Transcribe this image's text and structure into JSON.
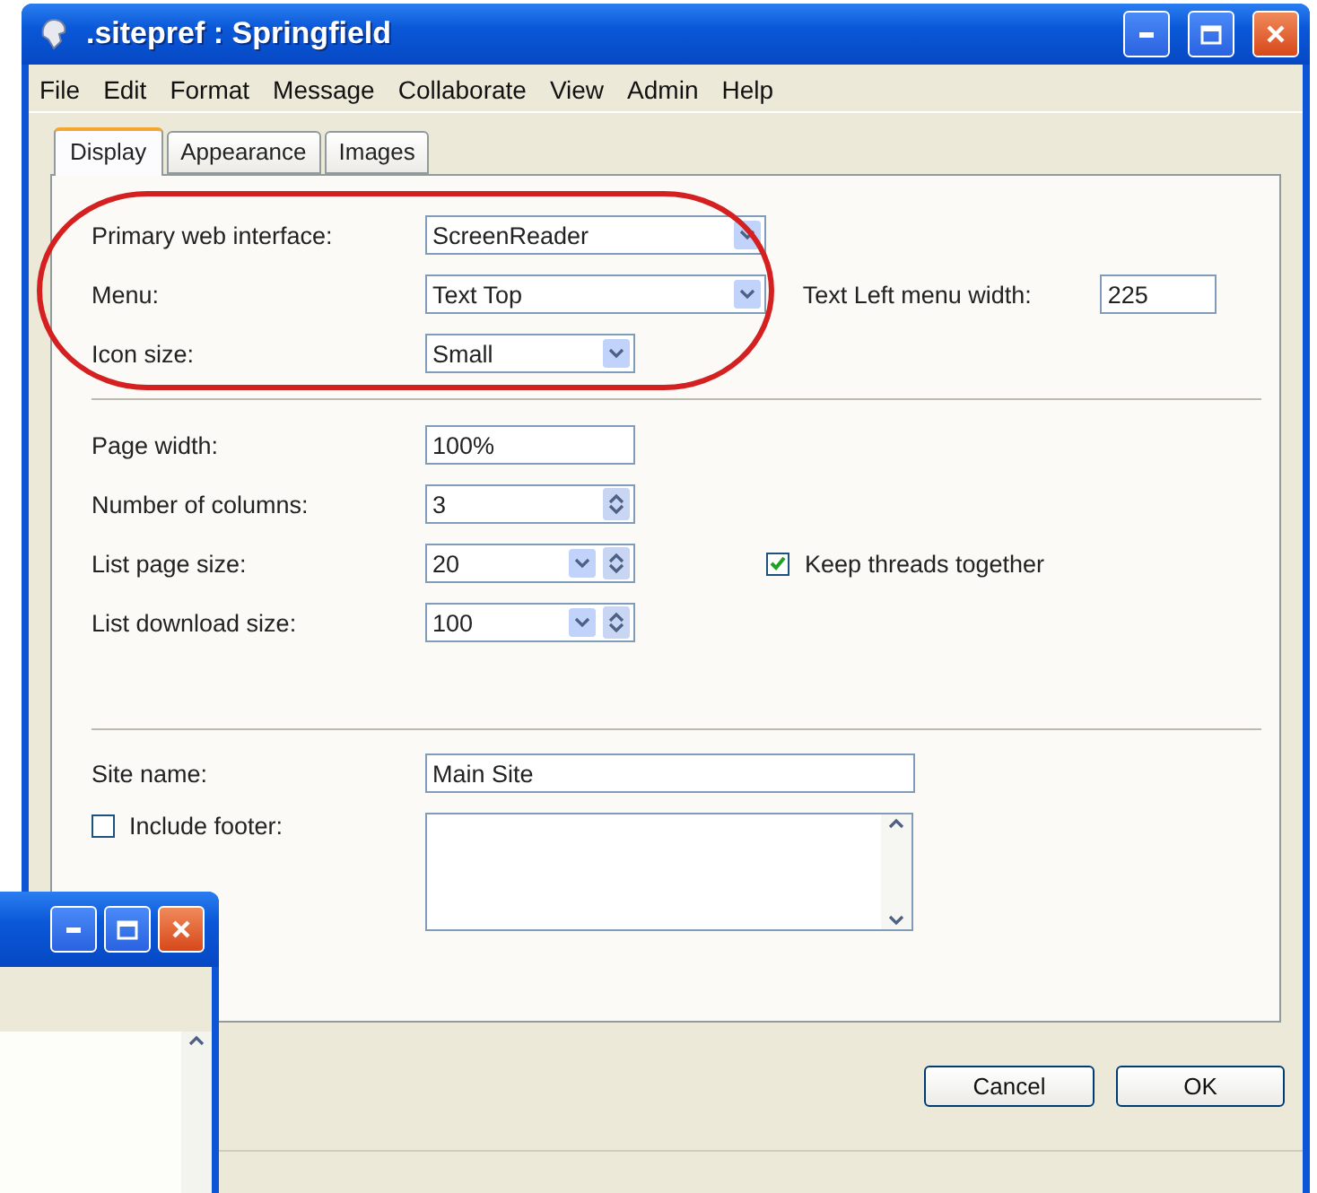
{
  "window": {
    "title": ".sitepref : Springfield"
  },
  "menu": [
    "File",
    "Edit",
    "Format",
    "Message",
    "Collaborate",
    "View",
    "Admin",
    "Help"
  ],
  "tabs": [
    {
      "label": "Display",
      "selected": true
    },
    {
      "label": "Appearance",
      "selected": false
    },
    {
      "label": "Images",
      "selected": false
    }
  ],
  "sections": [
    {
      "rows": [
        {
          "kind": "combo",
          "label": "Primary web interface:",
          "value": "ScreenReader"
        },
        {
          "kind": "combo",
          "label": "Menu:",
          "value": "Text Top",
          "side_label": "Text Left menu width:",
          "side_value": "225"
        },
        {
          "kind": "combo_short",
          "label": "Icon size:",
          "value": "Small"
        }
      ]
    },
    {
      "rows": [
        {
          "kind": "text",
          "label": "Page width:",
          "value": "100%"
        },
        {
          "kind": "spinner",
          "label": "Number of columns:",
          "value": "3"
        },
        {
          "kind": "combo_spinner",
          "label": "List page size:",
          "value": "20",
          "checkbox": {
            "label": "Keep threads together",
            "checked": true
          }
        },
        {
          "kind": "combo_spinner",
          "label": "List download size:",
          "value": "100"
        }
      ]
    },
    {
      "rows": [
        {
          "kind": "wide_text",
          "label": "Site name:",
          "value": "Main Site"
        },
        {
          "kind": "checkbox_area",
          "label": "Include footer:",
          "checked": false
        }
      ]
    }
  ],
  "buttons": [
    "Cancel",
    "OK"
  ]
}
